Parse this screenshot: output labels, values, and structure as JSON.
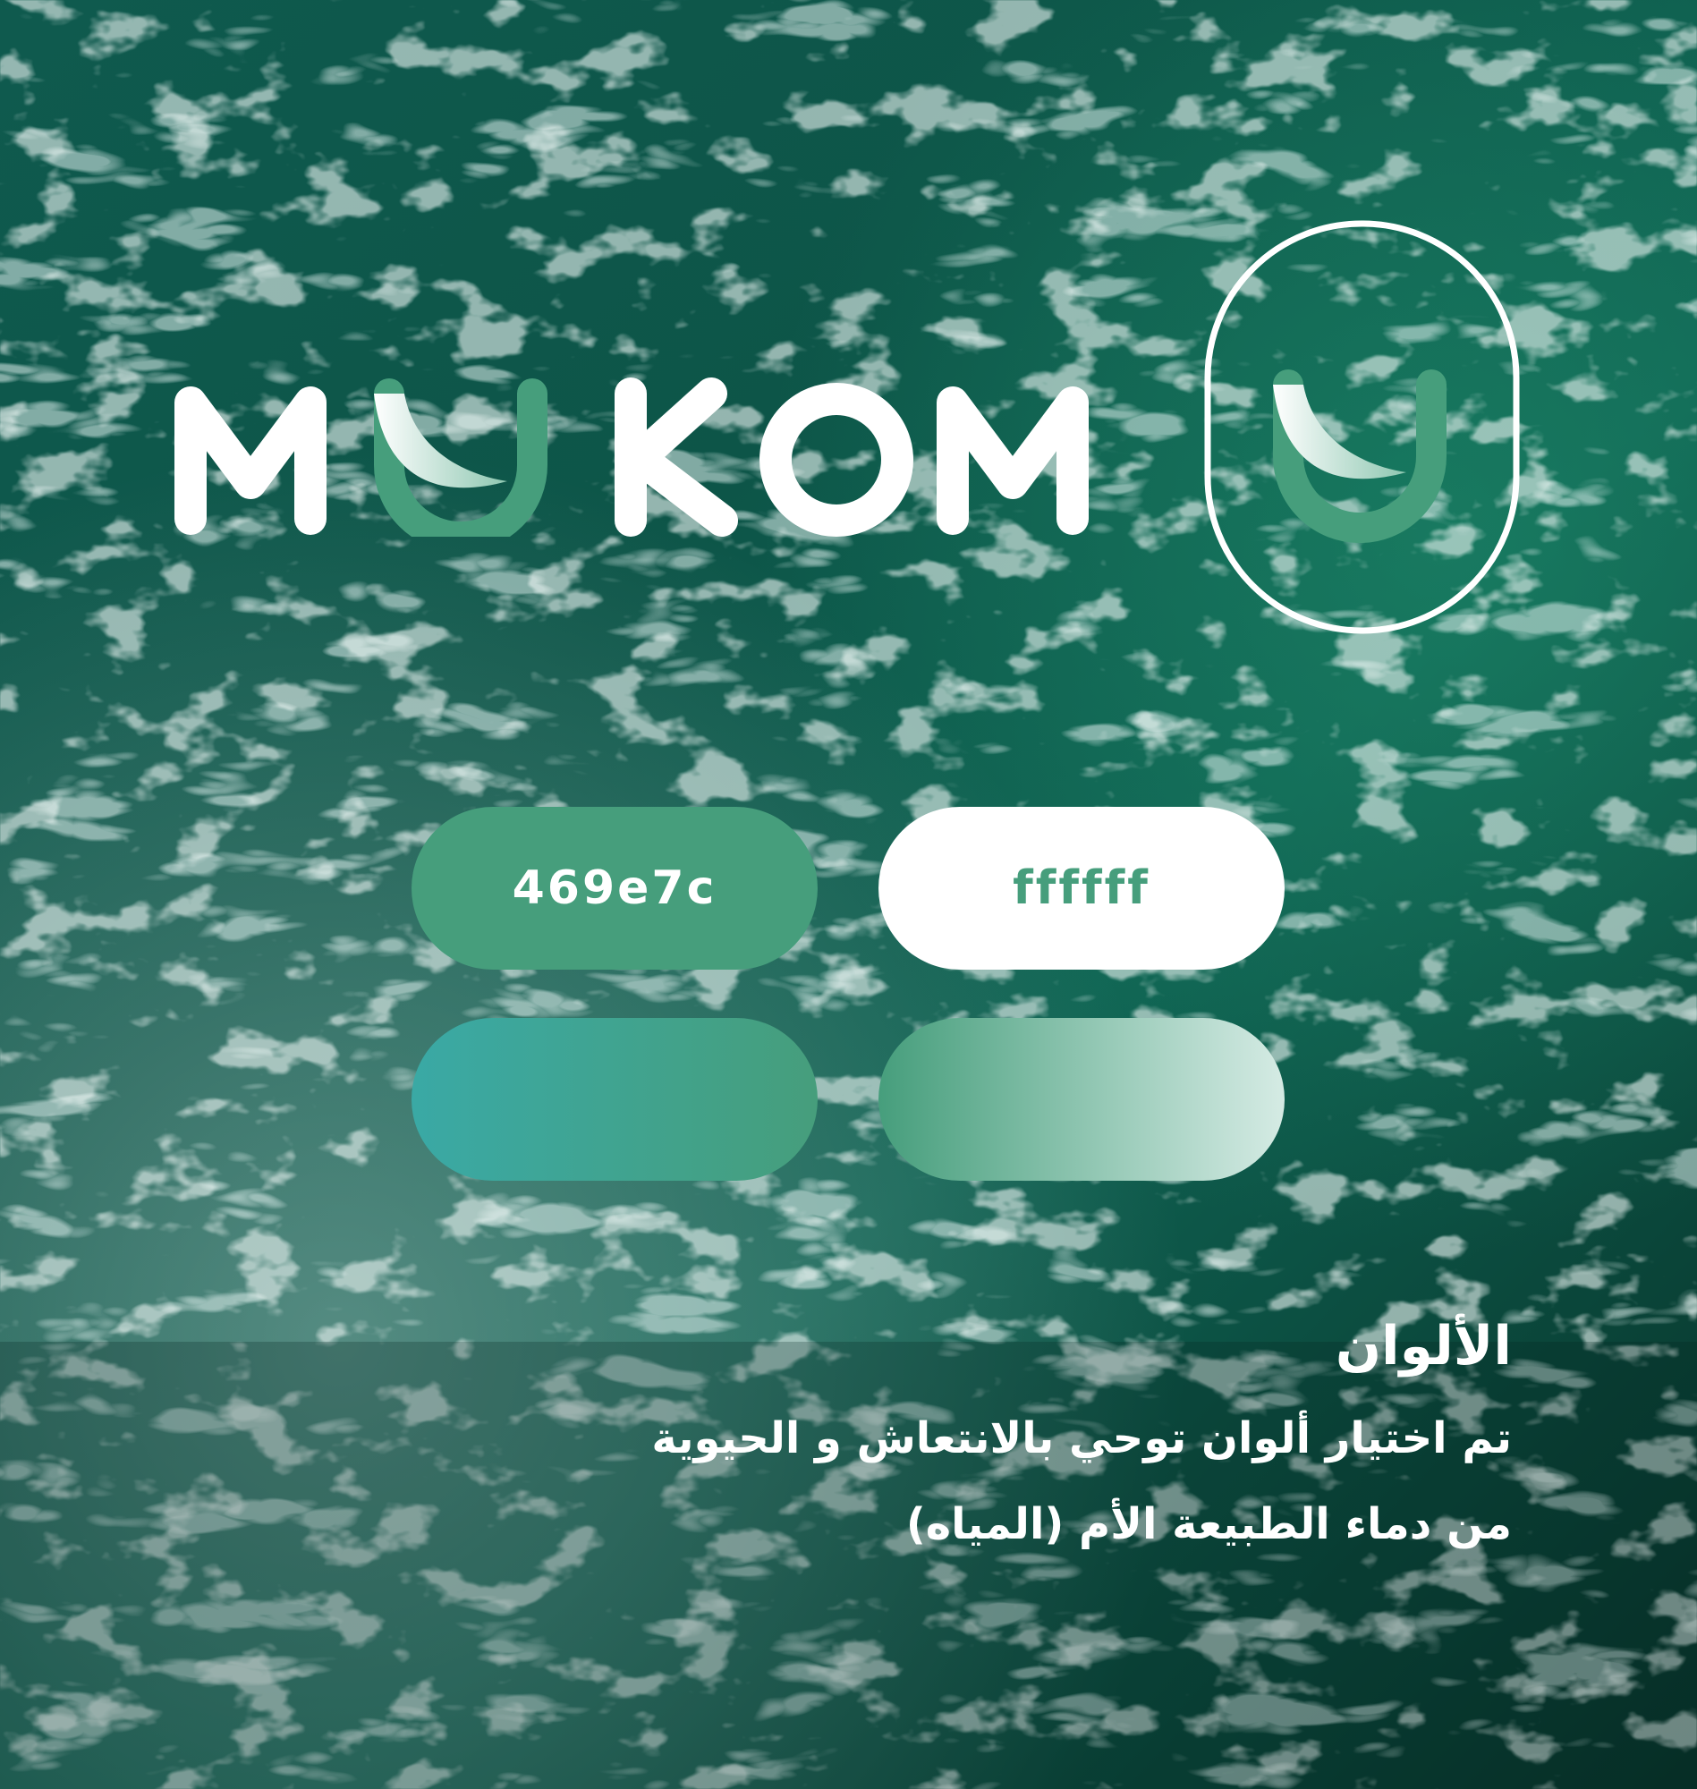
{
  "brand": {
    "wordmark_letters": [
      "M",
      "U",
      "K",
      "O",
      "M"
    ],
    "wordmark_text": "MUKOM",
    "emblem_icon": "wave-u-emblem-icon",
    "colors": {
      "primary": "#469e7c",
      "white": "#ffffff",
      "light_tint": "#d5ebe4",
      "teal": "#3aa9a5"
    }
  },
  "palette": {
    "swatches": [
      {
        "label": "469e7c",
        "color": "#469e7c",
        "text_color": "#ffffff"
      },
      {
        "label": "ffffff",
        "color": "#ffffff",
        "text_color": "#469e7c"
      },
      {
        "label": "",
        "gradient": [
          "#3aa9a5",
          "#469e7c"
        ]
      },
      {
        "label": "",
        "gradient": [
          "#469e7c",
          "#d5ebe4"
        ]
      }
    ]
  },
  "section": {
    "title": "الألوان",
    "lines": [
      "تم اختيار ألوان توحي بالانتعاش و الحيوية",
      "من دماء الطبيعة الأم (المياه)"
    ]
  },
  "background": {
    "icon": "ocean-waves-background",
    "colors": [
      "#0d4a40",
      "#1f7a68",
      "#c9dcd6"
    ]
  }
}
